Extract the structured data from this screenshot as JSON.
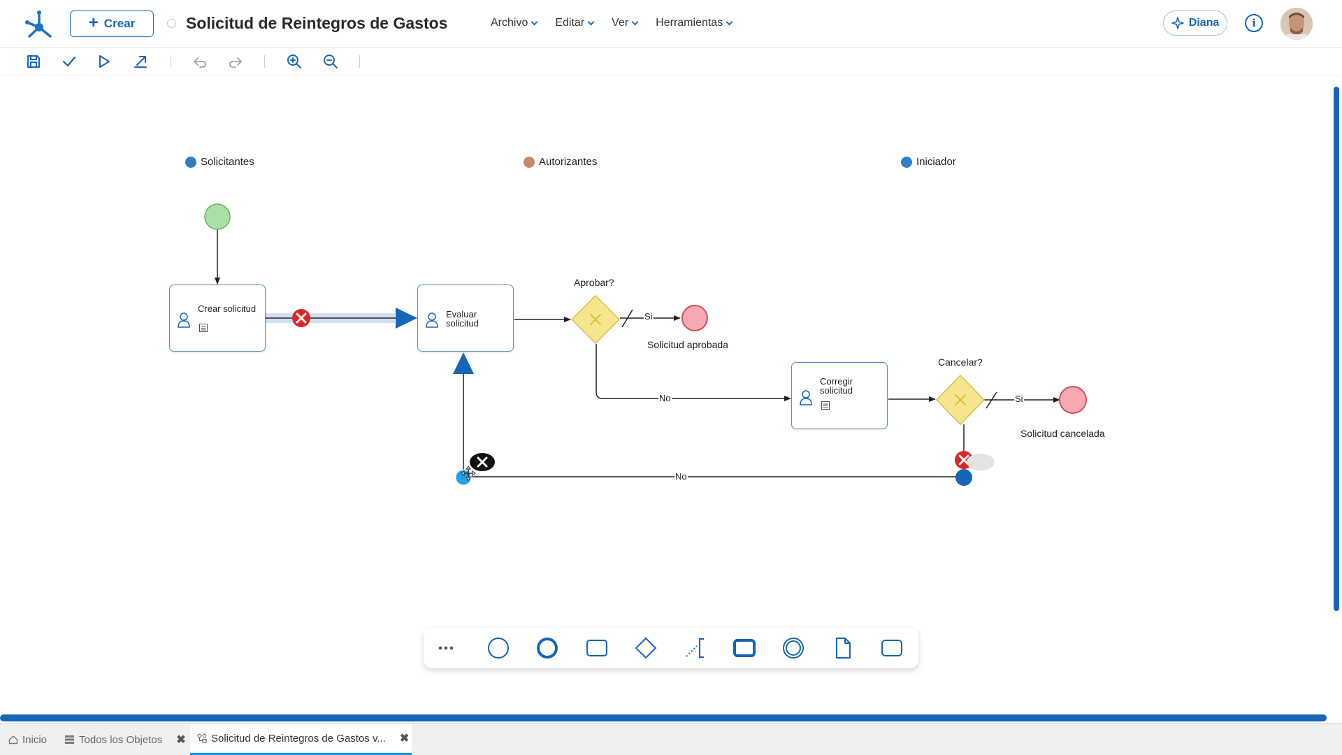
{
  "header": {
    "create_label": "Crear",
    "title": "Solicitud de Reintegros de Gastos",
    "menu": [
      {
        "label": "Archivo"
      },
      {
        "label": "Editar"
      },
      {
        "label": "Ver"
      },
      {
        "label": "Herramientas"
      }
    ],
    "assistant_label": "Diana",
    "info_icon": "info-icon",
    "avatar_icon": "user-avatar"
  },
  "toolbar": {
    "buttons": [
      "save-icon",
      "check-icon",
      "play-icon",
      "export-icon",
      "undo-icon",
      "redo-icon",
      "zoom-in-icon",
      "zoom-out-icon"
    ]
  },
  "diagram": {
    "lanes": [
      {
        "label": "Solicitantes"
      },
      {
        "label": "Autorizantes"
      },
      {
        "label": "Iniciador"
      }
    ],
    "tasks": [
      {
        "label": "Crear solicitud"
      },
      {
        "label": "Evaluar solicitud"
      },
      {
        "label": "Corregir solicitud"
      }
    ],
    "gateways": [
      {
        "label": "Aprobar?"
      },
      {
        "label": "Cancelar?"
      }
    ],
    "end_events": [
      {
        "label": "Solicitud aprobada"
      },
      {
        "label": "Solicitud cancelada"
      }
    ],
    "flow_labels": {
      "approve_yes": "Si",
      "approve_no": "No",
      "cancel_yes": "Si",
      "cancel_no": "No"
    },
    "colors": {
      "start_fill": "#a8e0a8",
      "end_fill": "#f6a9b0",
      "gateway_fill": "#f7e58e",
      "accent": "#1565b8"
    }
  },
  "palette": {
    "items": [
      "more-icon",
      "start-event-icon",
      "end-event-icon",
      "task-icon",
      "gateway-icon",
      "annotation-icon",
      "subprocess-icon",
      "intermediate-event-icon",
      "data-object-icon",
      "group-icon"
    ]
  },
  "tabs": [
    {
      "label": "Inicio"
    },
    {
      "label": "Todos los Objetos"
    },
    {
      "label": "Solicitud de Reintegros de Gastos v..."
    }
  ]
}
